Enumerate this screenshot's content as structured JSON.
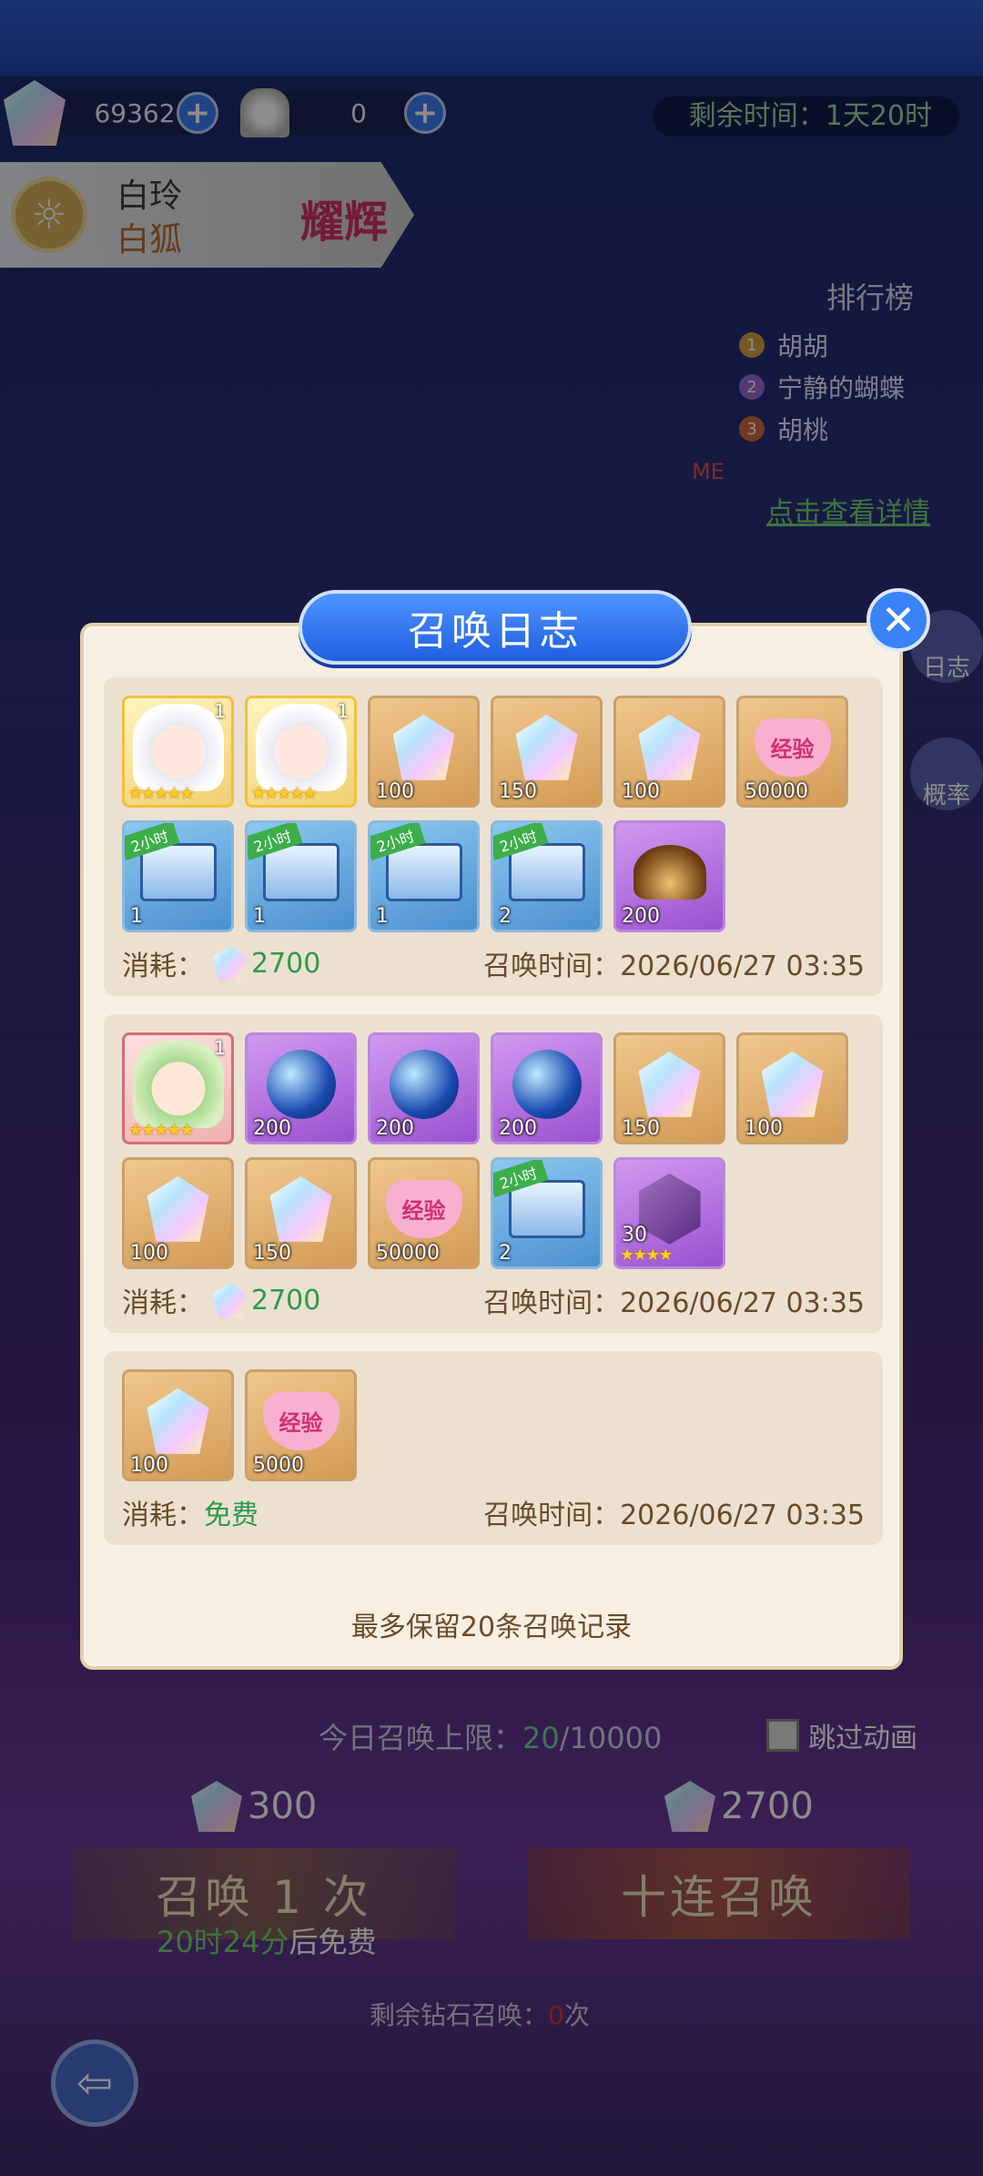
{
  "resources": {
    "gems": "69362",
    "dress_tickets": "0",
    "time_left": "剩余时间：1天20时"
  },
  "character": {
    "name": "白玲",
    "subtitle": "白狐",
    "badge": "耀辉"
  },
  "ranking": {
    "title": "排行榜",
    "entries": [
      {
        "rank": "1",
        "name": "胡胡"
      },
      {
        "rank": "2",
        "name": "宁静的蝴蝶"
      },
      {
        "rank": "3",
        "name": "胡桃"
      }
    ],
    "me_label": "ME",
    "details_link": "点击查看详情"
  },
  "side_buttons": {
    "log": "日志",
    "rate": "概率"
  },
  "dialog": {
    "title": "召唤日志",
    "footer": "最多保留20条召唤记录",
    "cost_label": "消耗：",
    "time_label": "召唤时间：",
    "records": [
      {
        "items": [
          {
            "type": "char",
            "level": "1",
            "stars": "★★★★★"
          },
          {
            "type": "char",
            "level": "1",
            "stars": "★★★★★"
          },
          {
            "type": "gem",
            "qty": "100"
          },
          {
            "type": "gem",
            "qty": "150"
          },
          {
            "type": "gem",
            "qty": "100"
          },
          {
            "type": "exp",
            "qty": "50000",
            "text": "经验"
          },
          {
            "type": "chest",
            "qty": "1",
            "ribbon": "2小时"
          },
          {
            "type": "chest",
            "qty": "1",
            "ribbon": "2小时"
          },
          {
            "type": "chest",
            "qty": "1",
            "ribbon": "2小时"
          },
          {
            "type": "chest",
            "qty": "2",
            "ribbon": "2小时"
          },
          {
            "type": "hat",
            "qty": "200"
          }
        ],
        "cost": "2700",
        "time": "2026/06/27 03:35"
      },
      {
        "items": [
          {
            "type": "char-green",
            "level": "1",
            "stars": "★★★★★"
          },
          {
            "type": "orb",
            "qty": "200"
          },
          {
            "type": "orb",
            "qty": "200"
          },
          {
            "type": "orb",
            "qty": "200"
          },
          {
            "type": "gem",
            "qty": "150"
          },
          {
            "type": "gem",
            "qty": "100"
          },
          {
            "type": "gem",
            "qty": "100"
          },
          {
            "type": "gem",
            "qty": "150"
          },
          {
            "type": "exp",
            "qty": "50000",
            "text": "经验"
          },
          {
            "type": "chest",
            "qty": "2",
            "ribbon": "2小时"
          },
          {
            "type": "crystal",
            "qty": "30",
            "stars": "★★★★"
          }
        ],
        "cost": "2700",
        "time": "2026/06/27 03:35"
      },
      {
        "items": [
          {
            "type": "gem",
            "qty": "100"
          },
          {
            "type": "exp",
            "qty": "5000",
            "text": "经验"
          }
        ],
        "cost": "免费",
        "time": "2026/06/27 03:35"
      }
    ]
  },
  "bottom": {
    "limit_prefix": "今日召唤上限：",
    "limit_used": "20",
    "limit_total": "/10000",
    "skip_anim": "跳过动画",
    "cost_single": "300",
    "cost_ten": "2700",
    "btn_single": "召唤 1 次",
    "btn_ten": "十连召唤",
    "free_time": "20时24分",
    "free_suffix": "后免费",
    "remain_prefix": "剩余钻石召唤：",
    "remain_count": "0",
    "remain_suffix": "次"
  }
}
